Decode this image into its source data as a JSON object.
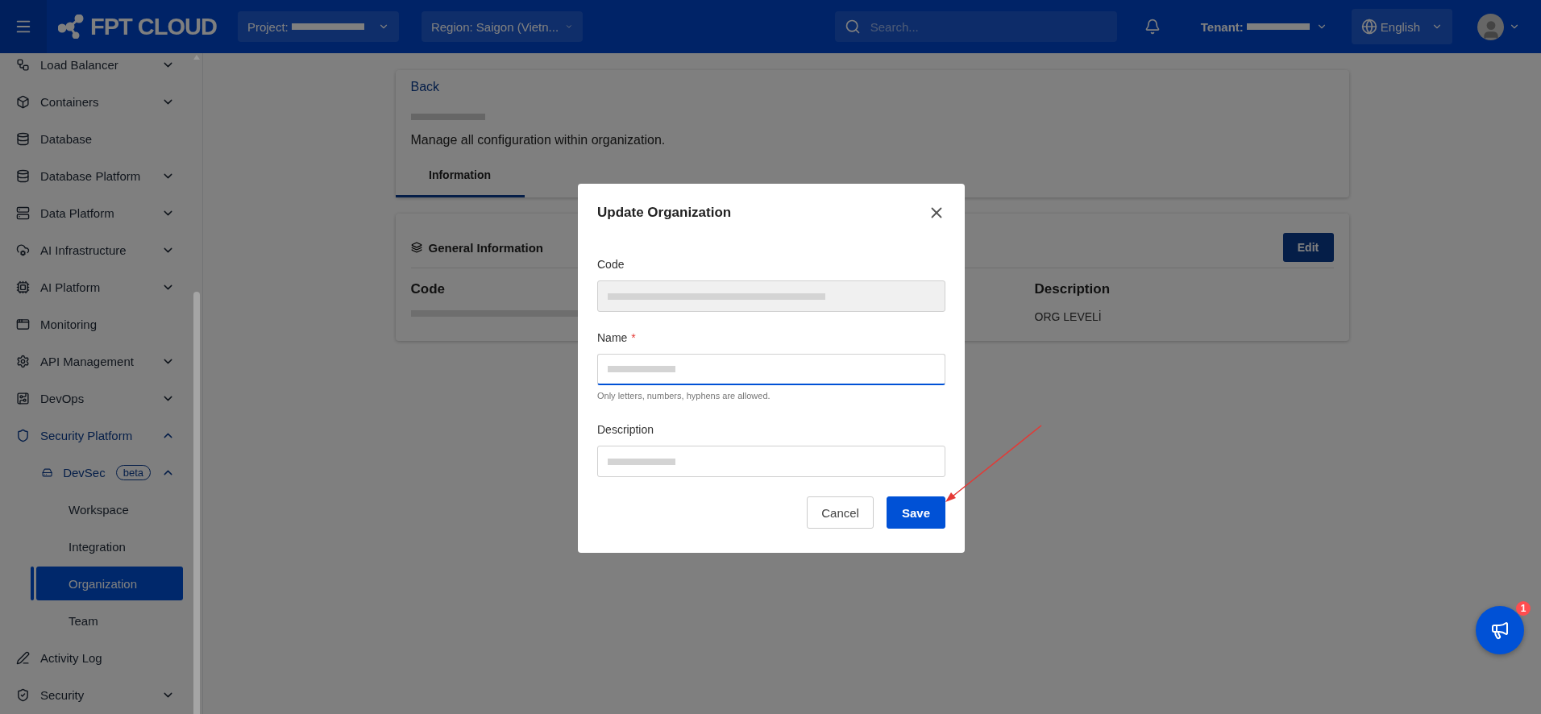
{
  "topbar": {
    "logo": "FPT CLOUD",
    "project": {
      "label": "Project:",
      "redacted": true
    },
    "region": {
      "label": "Region: Saigon (Vietn..."
    },
    "search": {
      "placeholder": "Search..."
    },
    "tenant": {
      "label": "Tenant:",
      "redacted": true
    },
    "language": {
      "label": "English"
    }
  },
  "sidebar": {
    "items": [
      {
        "label": "Load Balancer",
        "kind": "group",
        "expanded": false,
        "active": false,
        "selected": false
      },
      {
        "label": "Containers",
        "kind": "group",
        "expanded": false,
        "active": false,
        "selected": false
      },
      {
        "label": "Database",
        "kind": "link",
        "active": false,
        "selected": false
      },
      {
        "label": "Database Platform",
        "kind": "group",
        "expanded": false,
        "active": false,
        "selected": false
      },
      {
        "label": "Data Platform",
        "kind": "group",
        "expanded": false,
        "active": false,
        "selected": false
      },
      {
        "label": "AI Infrastructure",
        "kind": "group",
        "expanded": false,
        "active": false,
        "selected": false
      },
      {
        "label": "AI Platform",
        "kind": "group",
        "expanded": false,
        "active": false,
        "selected": false
      },
      {
        "label": "Monitoring",
        "kind": "link",
        "active": false,
        "selected": false
      },
      {
        "label": "API Management",
        "kind": "group",
        "expanded": false,
        "active": false,
        "selected": false
      },
      {
        "label": "DevOps",
        "kind": "group",
        "expanded": false,
        "active": false,
        "selected": false
      },
      {
        "label": "Security Platform",
        "kind": "group",
        "expanded": true,
        "active": true,
        "selected": false,
        "children": [
          {
            "label": "DevSec",
            "badge": "beta",
            "kind": "group",
            "expanded": true,
            "active": true,
            "selected": false,
            "children": [
              {
                "label": "Workspace",
                "kind": "link",
                "active": false,
                "selected": false
              },
              {
                "label": "Integration",
                "kind": "link",
                "active": false,
                "selected": false
              },
              {
                "label": "Organization",
                "kind": "link",
                "active": false,
                "selected": true
              },
              {
                "label": "Team",
                "kind": "link",
                "active": false,
                "selected": false
              }
            ]
          }
        ]
      },
      {
        "label": "Activity Log",
        "kind": "link",
        "active": false,
        "selected": false
      },
      {
        "label": "Security",
        "kind": "group",
        "expanded": false,
        "active": false,
        "selected": false
      }
    ]
  },
  "page": {
    "back": "Back",
    "title": {
      "redacted": true
    },
    "subtitle": "Manage all configuration within organization.",
    "tabs": [
      {
        "label": "Information",
        "selected": true
      }
    ],
    "general": {
      "title": "General Information",
      "edit": "Edit",
      "columns": [
        {
          "header": "Code",
          "redacted": true
        },
        {
          "header": "Description",
          "value": "ORG LEVELİ"
        }
      ]
    }
  },
  "modal": {
    "title": "Update Organization",
    "fields": [
      {
        "label": "Code",
        "disabled": true,
        "focused": false,
        "redacted": true
      },
      {
        "label": "Name",
        "required_mark": "*",
        "disabled": false,
        "focused": true,
        "redacted": true,
        "hint": "Only letters, numbers, hyphens are allowed."
      },
      {
        "label": "Description",
        "disabled": false,
        "focused": false,
        "redacted": true
      }
    ],
    "buttons": [
      {
        "label": "Cancel",
        "kind": "secondary"
      },
      {
        "label": "Save",
        "kind": "primary"
      }
    ]
  },
  "fab": {
    "badge": "1"
  }
}
